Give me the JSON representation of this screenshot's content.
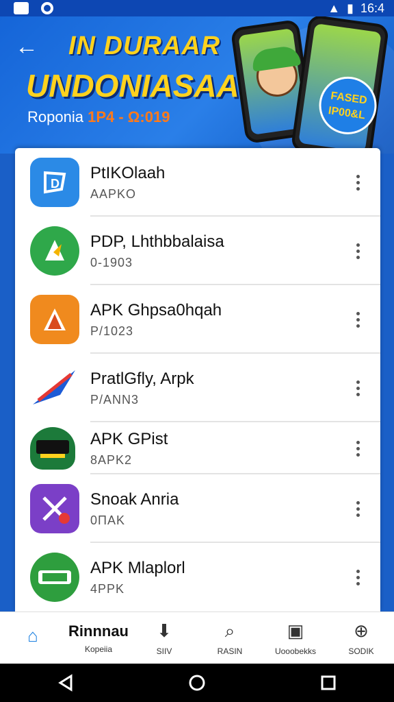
{
  "status_bar": {
    "time": "16:4"
  },
  "banner": {
    "title_line1": "IN DURAAR",
    "title_line2": "UNDONIASAAI",
    "subtitle_prefix": "Roponia",
    "subtitle_highlight": "1P4 - Ω:019",
    "badge_text": "FASED IP00&L"
  },
  "apps": [
    {
      "name": "PtIKOlaah",
      "subtitle": "AAPKO",
      "icon": "apk-blue-d-icon",
      "color": "#2b8ae6"
    },
    {
      "name": "PDP, Lhthbbalaisa",
      "subtitle": "0-1903",
      "icon": "apk-green-arrow-icon",
      "color": "#2fa84a"
    },
    {
      "name": "APK Ghpsa0hqah",
      "subtitle": "P/1023",
      "icon": "apk-orange-tent-icon",
      "color": "#f08a1e"
    },
    {
      "name": "PratlGfly, Arpk",
      "subtitle": "P/ANN3",
      "icon": "apk-pennant-icon",
      "color": "#ffffff"
    },
    {
      "name": "APK GPist",
      "subtitle": "8APK2",
      "icon": "apk-shield-icon",
      "color": "#1c7a3a"
    },
    {
      "name": "Snoak Anria",
      "subtitle": "0ΠΑΚ",
      "icon": "apk-purple-x-icon",
      "color": "#7b3fc7"
    },
    {
      "name": "APK Mlaplorl",
      "subtitle": "4PPK",
      "icon": "apk-green-badge-icon",
      "color": "#2e9e3e"
    }
  ],
  "bottom_nav": [
    {
      "label": "",
      "icon": "home-icon",
      "active": true
    },
    {
      "label": "Kopeiia",
      "icon": "",
      "big_label": "Rinnnau"
    },
    {
      "label": "SIIV",
      "icon": "download-icon"
    },
    {
      "label": "RASIN",
      "icon": "search-icon"
    },
    {
      "label": "Uooobekks",
      "icon": "gift-icon"
    },
    {
      "label": "SODIK",
      "icon": "settings-icon"
    }
  ]
}
